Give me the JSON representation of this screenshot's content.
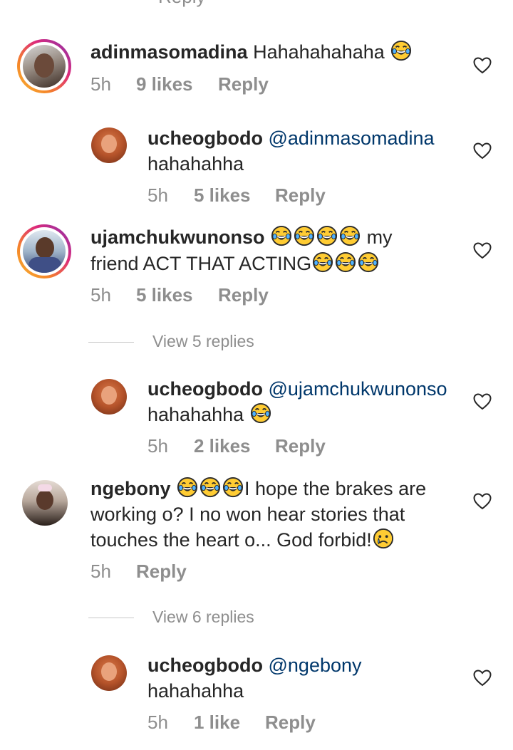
{
  "top_partial": "Reply",
  "comments": [
    {
      "username": "adinmasomadina",
      "text": "Hahahahahaha",
      "emoji_after": 1,
      "time": "5h",
      "likes": "9 likes",
      "reply": "Reply"
    },
    {
      "username": "ucheogbodo",
      "mention": "@adinmasomadina",
      "text": "hahahahha",
      "time": "5h",
      "likes": "5 likes",
      "reply": "Reply"
    },
    {
      "username": "ujamchukwunonso",
      "text_line1_after": "my",
      "text_line2": "friend ACT THAT ACTING",
      "emoji_line1": 4,
      "emoji_line2": 3,
      "time": "5h",
      "likes": "5 likes",
      "reply": "Reply",
      "view_replies": "View 5 replies"
    },
    {
      "username": "ucheogbodo",
      "mention": "@ujamchukwunonso",
      "text": "hahahahha",
      "emoji_after": 1,
      "time": "5h",
      "likes": "2 likes",
      "reply": "Reply"
    },
    {
      "username": "ngebony",
      "emoji_line1": 3,
      "text_line1": "I hope the brakes are",
      "text_line2": "working o? I no won hear stories that",
      "text_line3": "touches the heart o... God forbid!",
      "time": "5h",
      "reply": "Reply",
      "view_replies": "View 6 replies"
    },
    {
      "username": "ucheogbodo",
      "mention": "@ngebony",
      "text": "hahahahha",
      "time": "5h",
      "likes": "1 like",
      "reply": "Reply"
    }
  ],
  "icons": {
    "like": "heart-outline-icon",
    "laugh": "face-with-tears-of-joy-emoji",
    "sad": "crying-face-emoji"
  },
  "colors": {
    "text": "#262626",
    "meta": "#8e8e8e",
    "mention": "#00376b"
  }
}
